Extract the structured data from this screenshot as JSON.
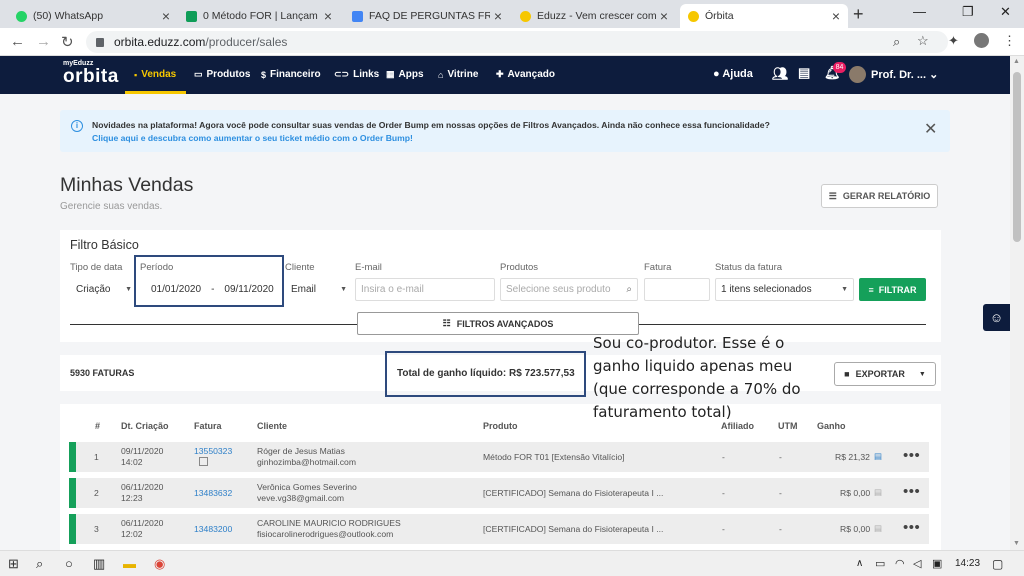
{
  "browser": {
    "tabs": [
      {
        "title": "(50) WhatsApp",
        "color": "#25d366"
      },
      {
        "title": "0 Método FOR | Lançam",
        "color": "#0f9d58"
      },
      {
        "title": "FAQ DE PERGUNTAS FREQU",
        "color": "#4285f4"
      },
      {
        "title": "Eduzz - Vem crescer com a",
        "color": "#f6c700"
      },
      {
        "title": "Órbita",
        "color": "#f6c700"
      }
    ],
    "url_host": "orbita.eduzz.com",
    "url_path": "/producer/sales"
  },
  "header": {
    "logo_small": "myEduzz",
    "logo_big": "orbita",
    "nav": [
      "Vendas",
      "Produtos",
      "Financeiro",
      "Links",
      "Apps",
      "Vitrine",
      "Avançado"
    ],
    "help": "Ajuda",
    "notifications": "84",
    "user": "Prof. Dr. ..."
  },
  "notice": {
    "line1": "Novidades na plataforma! Agora você pode consultar suas vendas de Order Bump em nossas opções de Filtros Avançados. Ainda não conhece essa funcionalidade?",
    "line2": "Clique aqui e descubra como aumentar o seu ticket médio com o Order Bump!"
  },
  "page": {
    "title": "Minhas Vendas",
    "subtitle": "Gerencie suas vendas.",
    "report_button": "GERAR RELATÓRIO"
  },
  "filter": {
    "title": "Filtro Básico",
    "labels": {
      "tipo": "Tipo de data",
      "periodo": "Período",
      "cliente": "Cliente",
      "email": "E-mail",
      "produtos": "Produtos",
      "fatura": "Fatura",
      "status": "Status da fatura"
    },
    "tipo_value": "Criação",
    "date_from": "01/01/2020",
    "date_sep": "-",
    "date_to": "09/11/2020",
    "cliente_value": "Email",
    "email_placeholder": "Insira o e-mail",
    "produtos_placeholder": "Selecione seus produto",
    "status_value": "1 itens selecionados",
    "filter_button": "FILTRAR",
    "advanced_button": "FILTROS AVANÇADOS"
  },
  "summary": {
    "count": "5930 FATURAS",
    "total": "Total de ganho líquido: R$ 723.577,53",
    "export_button": "EXPORTAR"
  },
  "table": {
    "headers": [
      "#",
      "Dt. Criação",
      "Fatura",
      "Cliente",
      "Produto",
      "Afiliado",
      "UTM",
      "Ganho"
    ],
    "rows": [
      {
        "n": "1",
        "date": "09/11/2020",
        "time": "14:02",
        "invoice": "13550323",
        "name": "Róger de Jesus Matias",
        "email": "ginhozimba@hotmail.com",
        "product": "Método FOR T01 [Extensão Vitalício]",
        "affiliate": "-",
        "utm": "-",
        "gain": "R$ 21,32"
      },
      {
        "n": "2",
        "date": "06/11/2020",
        "time": "12:23",
        "invoice": "13483632",
        "name": "Verônica Gomes Severino",
        "email": "veve.vg38@gmail.com",
        "product": "[CERTIFICADO] Semana do Fisioterapeuta I ...",
        "affiliate": "-",
        "utm": "-",
        "gain": "R$ 0,00"
      },
      {
        "n": "3",
        "date": "06/11/2020",
        "time": "12:02",
        "invoice": "13483200",
        "name": "CAROLINE MAURICIO RODRIGUES",
        "email": "fisiocarolinerodrigues@outlook.com",
        "product": "[CERTIFICADO] Semana do Fisioterapeuta I ...",
        "affiliate": "-",
        "utm": "-",
        "gain": "R$ 0,00"
      }
    ]
  },
  "annotation": {
    "callout": "Sou co-produtor. Esse é o ganho liquido apenas meu (que corresponde a 70% do faturamento total)"
  },
  "taskbar": {
    "time": "14:23"
  },
  "colors": {
    "header_bg": "#0d1c3d",
    "accent": "#f6c700",
    "green": "#15a05a",
    "link": "#2d7fc8",
    "annotation": "#2e4a7d"
  }
}
